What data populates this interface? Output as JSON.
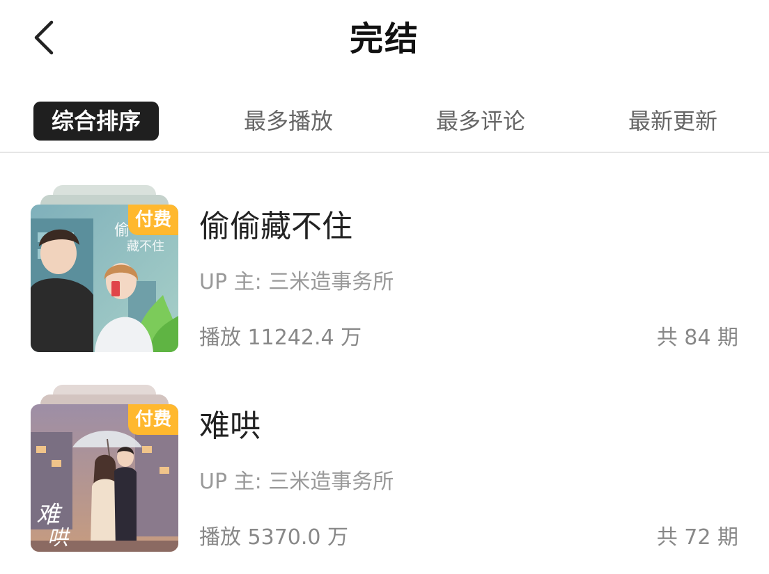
{
  "header": {
    "title": "完结",
    "back_icon": "chevron-left-icon"
  },
  "tabs": [
    {
      "label": "综合排序",
      "active": true
    },
    {
      "label": "最多播放",
      "active": false
    },
    {
      "label": "最多评论",
      "active": false
    },
    {
      "label": "最新更新",
      "active": false
    }
  ],
  "items": [
    {
      "title": "偷偷藏不住",
      "badge": "付费",
      "uploader": "UP 主: 三米造事务所",
      "plays": "播放 11242.4 万",
      "episodes": "共 84 期"
    },
    {
      "title": "难哄",
      "badge": "付费",
      "uploader": "UP 主: 三米造事务所",
      "plays": "播放 5370.0 万",
      "episodes": "共 72 期"
    }
  ],
  "colors": {
    "badge": "#ffb82e",
    "active_tab_bg": "#1f1f1f",
    "muted_text": "#888888"
  }
}
